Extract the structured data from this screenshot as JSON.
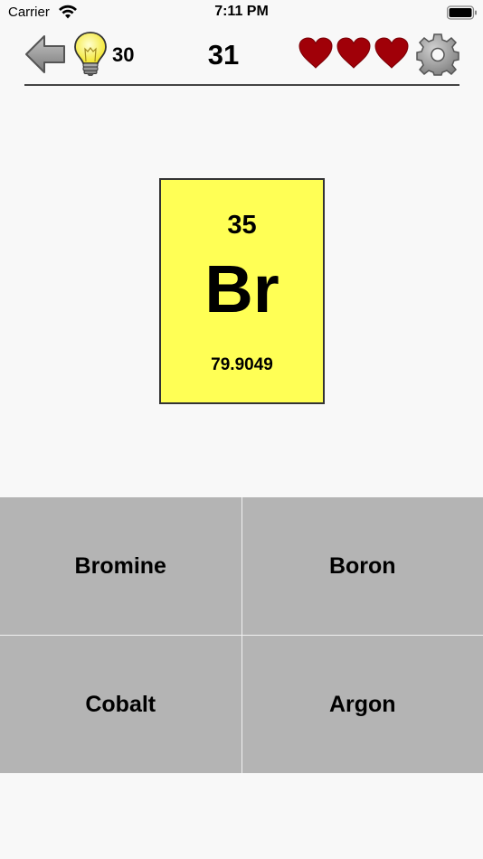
{
  "status_bar": {
    "carrier": "Carrier",
    "time": "7:11 PM"
  },
  "header": {
    "back_icon": "arrow-left-icon",
    "hint_icon": "lightbulb-icon",
    "hints_remaining": "30",
    "score": "31",
    "lives": 3,
    "life_icon": "heart-icon",
    "settings_icon": "gear-icon"
  },
  "element": {
    "atomic_number": "35",
    "symbol": "Br",
    "atomic_mass": "79.9049",
    "card_color": "#ffff55"
  },
  "answers": [
    {
      "label": "Bromine"
    },
    {
      "label": "Boron"
    },
    {
      "label": "Cobalt"
    },
    {
      "label": "Argon"
    }
  ],
  "colors": {
    "heart": "#a00008",
    "answer_bg": "#b4b4b4",
    "background": "#f8f8f8"
  }
}
